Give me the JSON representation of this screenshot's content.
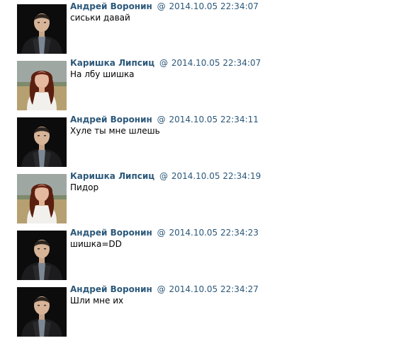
{
  "messages": [
    {
      "author": "Андрей Воронин",
      "at": "@",
      "timestamp": "2014.10.05 22:34:07",
      "text": "сиськи давай",
      "avatar": "andrey"
    },
    {
      "author": "Каришка Липсиц",
      "at": "@",
      "timestamp": "2014.10.05 22:34:07",
      "text": "На лбу шишка",
      "avatar": "karishka"
    },
    {
      "author": "Андрей Воронин",
      "at": "@",
      "timestamp": "2014.10.05 22:34:11",
      "text": "Хуле ты мне шлешь",
      "avatar": "andrey"
    },
    {
      "author": "Каришка Липсиц",
      "at": "@",
      "timestamp": "2014.10.05 22:34:19",
      "text": "Пидор",
      "avatar": "karishka"
    },
    {
      "author": "Андрей Воронин",
      "at": "@",
      "timestamp": "2014.10.05 22:34:23",
      "text": "шишка=DD",
      "avatar": "andrey"
    },
    {
      "author": "Андрей Воронин",
      "at": "@",
      "timestamp": "2014.10.05 22:34:27",
      "text": "Шли мне их",
      "avatar": "andrey"
    }
  ],
  "colors": {
    "link": "#2b587a",
    "text": "#000000",
    "background": "#ffffff"
  }
}
